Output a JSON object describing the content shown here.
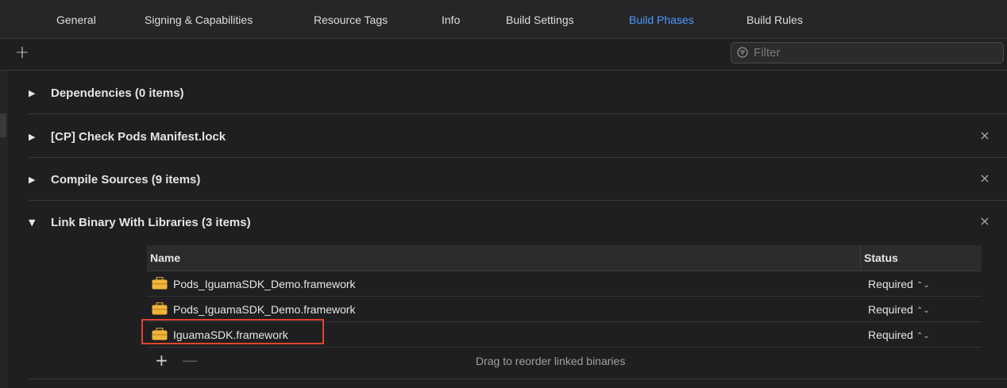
{
  "tabs": [
    {
      "label": "General",
      "active": false
    },
    {
      "label": "Signing & Capabilities",
      "active": false
    },
    {
      "label": "Resource Tags",
      "active": false
    },
    {
      "label": "Info",
      "active": false
    },
    {
      "label": "Build Settings",
      "active": false
    },
    {
      "label": "Build Phases",
      "active": true
    },
    {
      "label": "Build Rules",
      "active": false
    }
  ],
  "toolbar": {
    "add_label": "+",
    "filter_placeholder": "Filter"
  },
  "phases": [
    {
      "disclosure": "▶",
      "title": "Dependencies (0 items)",
      "removable": false
    },
    {
      "disclosure": "▶",
      "title": "[CP] Check Pods Manifest.lock",
      "removable": true,
      "close": "×"
    },
    {
      "disclosure": "▶",
      "title": "Compile Sources (9 items)",
      "removable": true,
      "close": "×"
    },
    {
      "disclosure": "▼",
      "title": "Link Binary With Libraries (3 items)",
      "removable": true,
      "close": "×"
    }
  ],
  "libraries": {
    "columns": {
      "name": "Name",
      "status": "Status"
    },
    "rows": [
      {
        "name": "Pods_IguamaSDK_Demo.framework",
        "status": "Required",
        "icon": "toolbox-icon"
      },
      {
        "name": "Pods_IguamaSDK_Demo.framework",
        "status": "Required",
        "icon": "toolbox-icon"
      },
      {
        "name": "IguamaSDK.framework",
        "status": "Required",
        "icon": "toolbox-icon",
        "highlighted": true
      }
    ],
    "footer": {
      "add": "+",
      "remove": "—",
      "hint": "Drag to reorder linked binaries"
    },
    "updown_glyph": "⌃⌄"
  },
  "colors": {
    "accent": "#4c9aff",
    "background": "#1f1f21",
    "highlight": "#e0442f",
    "toolbox_icon": "#f0b43c"
  }
}
